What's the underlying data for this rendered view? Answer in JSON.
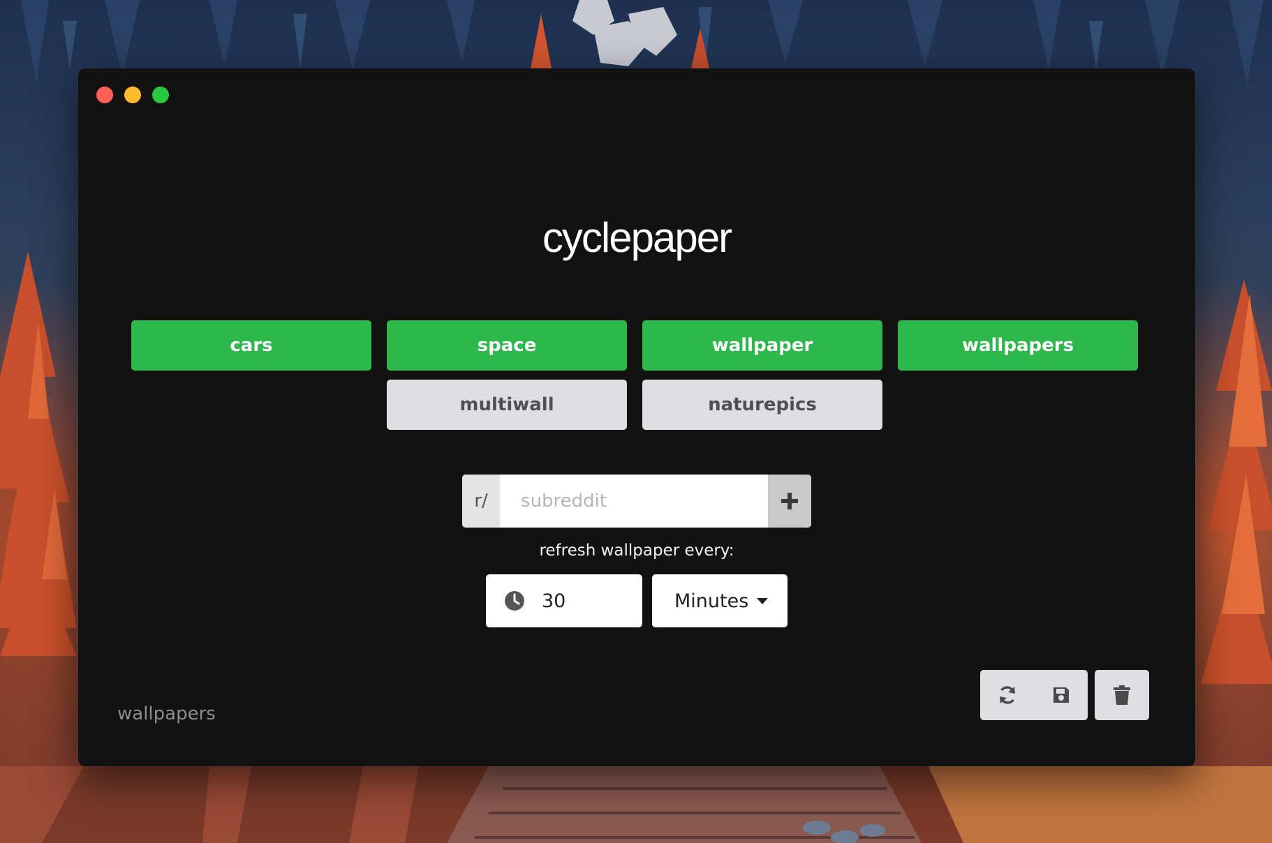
{
  "app": {
    "title": "cyclepaper"
  },
  "window_controls": {
    "close_color": "#fe5f57",
    "minimize_color": "#febc2e",
    "maximize_color": "#28c840"
  },
  "subreddits": {
    "active": [
      "cars",
      "space",
      "wallpaper",
      "wallpapers"
    ],
    "inactive": [
      "multiwall",
      "naturepics"
    ],
    "active_color": "#2cb84b",
    "inactive_color": "#dfdfe1"
  },
  "subreddit_input": {
    "prefix": "r/",
    "placeholder": "subreddit",
    "value": "",
    "add_icon": "plus-icon"
  },
  "refresh": {
    "label": "refresh wallpaper every:",
    "interval_value": "30",
    "interval_icon": "clock-icon",
    "unit": "Minutes"
  },
  "status": {
    "current_subreddit": "wallpapers"
  },
  "toolbar": {
    "refresh_icon": "refresh-icon",
    "save_icon": "save-icon",
    "delete_icon": "trash-icon"
  }
}
